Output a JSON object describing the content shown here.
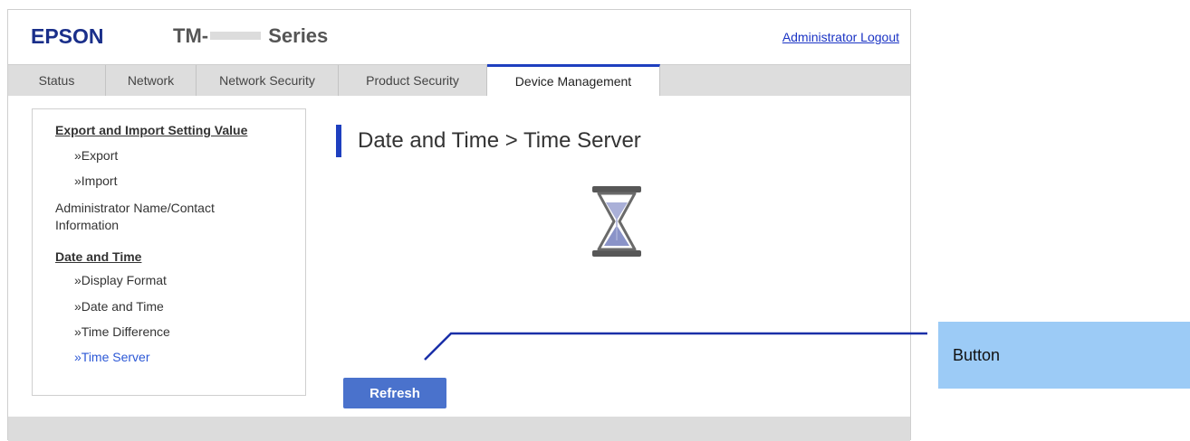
{
  "header": {
    "logo": "EPSON",
    "model_prefix": "TM-",
    "model_suffix": "Series",
    "logout_label": "Administrator Logout"
  },
  "tabs": [
    {
      "label": "Status",
      "active": false
    },
    {
      "label": "Network",
      "active": false
    },
    {
      "label": "Network Security",
      "active": false
    },
    {
      "label": "Product Security",
      "active": false
    },
    {
      "label": "Device Management",
      "active": true
    }
  ],
  "sidebar": {
    "section1_title": "Export and Import Setting Value",
    "section1_items": [
      "»Export",
      "»Import"
    ],
    "admin_item_line1": "Administrator Name/Contact",
    "admin_item_line2": "Information",
    "section2_title": "Date and Time",
    "section2_items": [
      "»Display Format",
      "»Date and Time",
      "»Time Difference",
      "»Time Server"
    ],
    "current_item": "»Time Server"
  },
  "main": {
    "title": "Date and Time > Time Server",
    "refresh_label": "Refresh"
  },
  "annotation": {
    "label": "Button"
  },
  "colors": {
    "brand_blue": "#1a2f8a",
    "accent": "#1e3fbf",
    "button": "#4a72cc",
    "callout": "#9ccbf6"
  }
}
